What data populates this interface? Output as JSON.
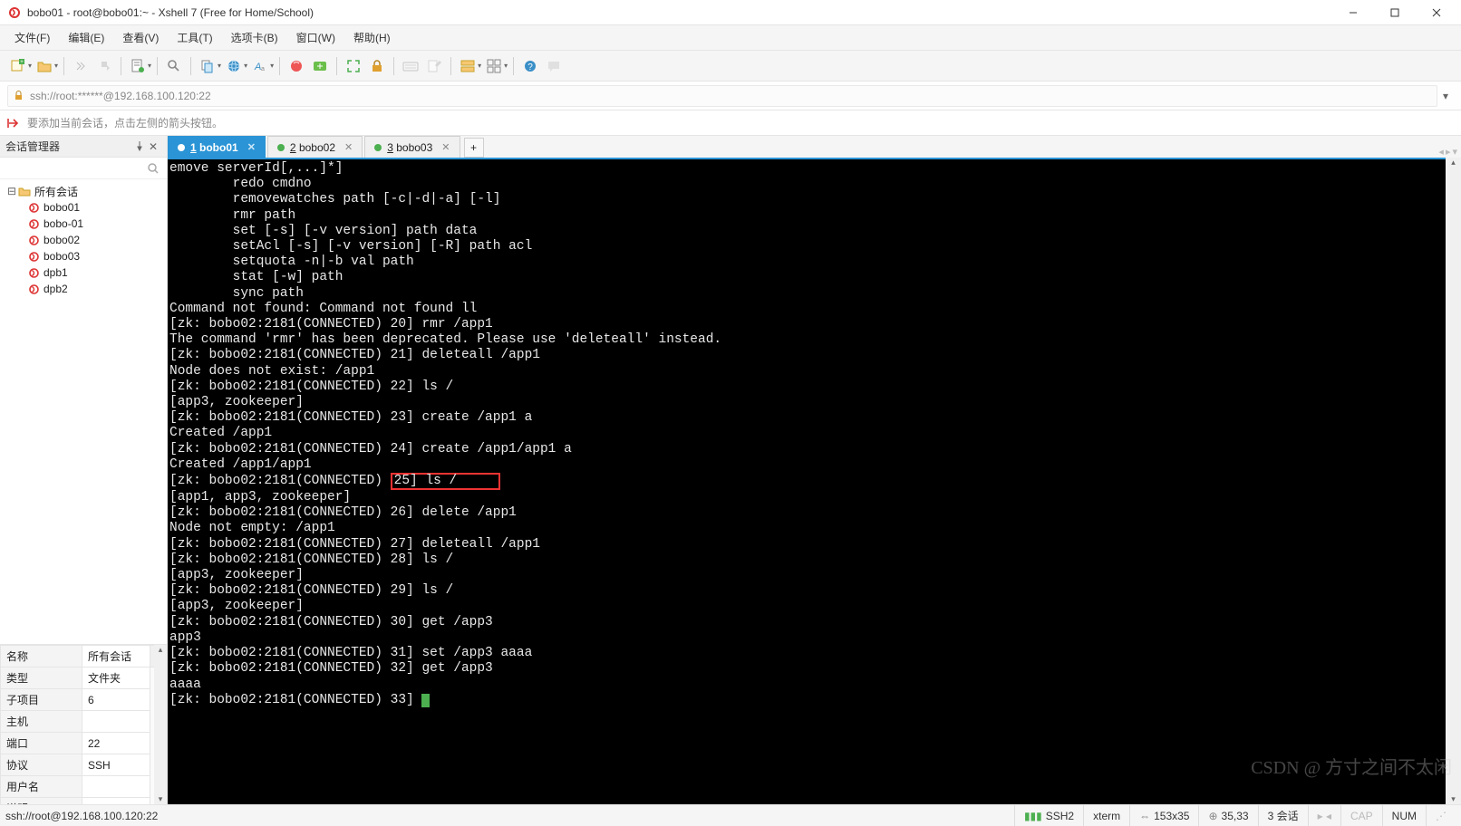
{
  "window": {
    "title": "bobo01 - root@bobo01:~ - Xshell 7 (Free for Home/School)"
  },
  "menu": {
    "file": "文件(F)",
    "edit": "编辑(E)",
    "view": "查看(V)",
    "tools": "工具(T)",
    "tab": "选项卡(B)",
    "window": "窗口(W)",
    "help": "帮助(H)"
  },
  "address": "ssh://root:******@192.168.100.120:22",
  "hint": "要添加当前会话，点击左侧的箭头按钮。",
  "sessionManager": {
    "title": "会话管理器",
    "root": "所有会话",
    "items": [
      "bobo01",
      "bobo-01",
      "bobo02",
      "bobo03",
      "dpb1",
      "dpb2"
    ]
  },
  "props": {
    "header_name": "名称",
    "header_val": "所有会话",
    "rows": [
      {
        "k": "类型",
        "v": "文件夹"
      },
      {
        "k": "子项目",
        "v": "6"
      },
      {
        "k": "主机",
        "v": ""
      },
      {
        "k": "端口",
        "v": "22"
      },
      {
        "k": "协议",
        "v": "SSH"
      },
      {
        "k": "用户名",
        "v": ""
      },
      {
        "k": "说明",
        "v": ""
      }
    ]
  },
  "tabs": [
    {
      "num": "1",
      "label": "bobo01",
      "active": true
    },
    {
      "num": "2",
      "label": "bobo02",
      "active": false
    },
    {
      "num": "3",
      "label": "bobo03",
      "active": false
    }
  ],
  "terminal": {
    "pre": "emove serverId[,...]*]\n        redo cmdno\n        removewatches path [-c|-d|-a] [-l]\n        rmr path\n        set [-s] [-v version] path data\n        setAcl [-s] [-v version] [-R] path acl\n        setquota -n|-b val path\n        stat [-w] path\n        sync path\nCommand not found: Command not found ll\n[zk: bobo02:2181(CONNECTED) 20] rmr /app1\nThe command 'rmr' has been deprecated. Please use 'deleteall' instead.\n[zk: bobo02:2181(CONNECTED) 21] deleteall /app1\nNode does not exist: /app1\n[zk: bobo02:2181(CONNECTED) 22] ls /\n[app3, zookeeper]\n[zk: bobo02:2181(CONNECTED) 23] create /app1 a\nCreated /app1\n[zk: bobo02:2181(CONNECTED) 24] create /app1/app1 a\nCreated /app1/app1",
    "hl_prefix": "[zk: bobo02:2181(CONNECTED) ",
    "hl_box": "25] ls /     ",
    "post": "[app1, app3, zookeeper]\n[zk: bobo02:2181(CONNECTED) 26] delete /app1\nNode not empty: /app1\n[zk: bobo02:2181(CONNECTED) 27] deleteall /app1\n[zk: bobo02:2181(CONNECTED) 28] ls /\n[app3, zookeeper]\n[zk: bobo02:2181(CONNECTED) 29] ls /\n[app3, zookeeper]\n[zk: bobo02:2181(CONNECTED) 30] get /app3\napp3\n[zk: bobo02:2181(CONNECTED) 31] set /app3 aaaa\n[zk: bobo02:2181(CONNECTED) 32] get /app3\naaaa",
    "prompt": "[zk: bobo02:2181(CONNECTED) 33] "
  },
  "status": {
    "left": "ssh://root@192.168.100.120:22",
    "ssh": "SSH2",
    "term": "xterm",
    "size": "153x35",
    "pos": "35,33",
    "sessions": "3 会话",
    "caps": "CAP",
    "num": "NUM"
  },
  "watermark": "CSDN @ 方寸之间不太闲"
}
